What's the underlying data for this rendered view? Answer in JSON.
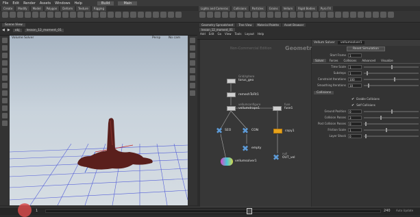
{
  "menu": [
    "File",
    "Edit",
    "Render",
    "Assets",
    "Windows",
    "Help"
  ],
  "shelf_tabs": [
    "Create",
    "Modify",
    "Model",
    "Polygon",
    "Deform",
    "Texture",
    "Rigging",
    "Characters",
    "Constraints",
    "Hair Utils",
    "Guide Process"
  ],
  "shelf_tabs_right": [
    "Lights and Cameras",
    "Collisions",
    "Particles",
    "Grains",
    "Vellum",
    "Rigid Bodies",
    "Particle Fluids",
    "Viscous Fluids",
    "Oceans",
    "Pyro FX",
    "FEM",
    "Wires",
    "Crowds",
    "Drive Simulation"
  ],
  "build_label": "Build",
  "main_label": "Main",
  "viewport": {
    "tab": "Scene View",
    "path_obj": "obj",
    "path_node": "lesson_12_moment_01",
    "persp": "Persp",
    "cam": "No cam",
    "title": "Volume Solver"
  },
  "network": {
    "tabs": [
      "Geometry Spreadsheet",
      "Tree View",
      "Material Palette",
      "Asset Browser"
    ],
    "path_node": "lesson_12_moment_01",
    "menu": [
      "Add",
      "Edit",
      "Go",
      "View",
      "Tools",
      "Layout",
      "Help"
    ],
    "context": "Non-Commercial Edition",
    "title": "Geometry"
  },
  "nodes": [
    {
      "label": "torus_geo",
      "sub": "Grid/sphere"
    },
    {
      "label": "remeshToFit1",
      "sub": ""
    },
    {
      "label": "vellumdrape1",
      "sub": "vellumconfigure"
    },
    {
      "label": "fuse1",
      "sub": "fuse"
    },
    {
      "label": "SEO",
      "sub": ""
    },
    {
      "label": "CON",
      "sub": ""
    },
    {
      "label": "copy1",
      "sub": ""
    },
    {
      "label": "empty",
      "sub": ""
    },
    {
      "label": "vellumsolver1",
      "sub": ""
    },
    {
      "label": "OUT_vel",
      "sub": "null"
    }
  ],
  "params": {
    "header": "Vellum Solver",
    "node_name": "vellumsolver1",
    "reset": "Reset Simulation",
    "start_frame_label": "Start Frame",
    "start_frame": "1",
    "tabs": [
      "Solver",
      "Forces",
      "Collisions",
      "Advanced",
      "Visualize"
    ],
    "rows": [
      {
        "name": "Time Scale",
        "value": "1"
      },
      {
        "name": "Substeps",
        "value": "1"
      },
      {
        "name": "Constraint Iterations",
        "value": "100"
      },
      {
        "name": "Smoothing Iterations",
        "value": "10"
      }
    ],
    "section": "Collisions",
    "checks": [
      "Enable Collisions",
      "Self Collisions"
    ],
    "rows2": [
      {
        "name": "Ground Position",
        "value": "0"
      },
      {
        "name": "Collision Passes",
        "value": "3"
      },
      {
        "name": "Post Collision Passes",
        "value": "0"
      },
      {
        "name": "Friction Scale",
        "value": "1"
      },
      {
        "name": "Layer Shock",
        "value": "0"
      }
    ]
  },
  "timeline": {
    "frame": "1",
    "end": "240",
    "fps": "Auto Update"
  },
  "colors": {
    "viewport_top": "#a9b6c4",
    "goo": "#5a1f1c",
    "node_bg": "#373737",
    "accent": "#e7a21b"
  }
}
